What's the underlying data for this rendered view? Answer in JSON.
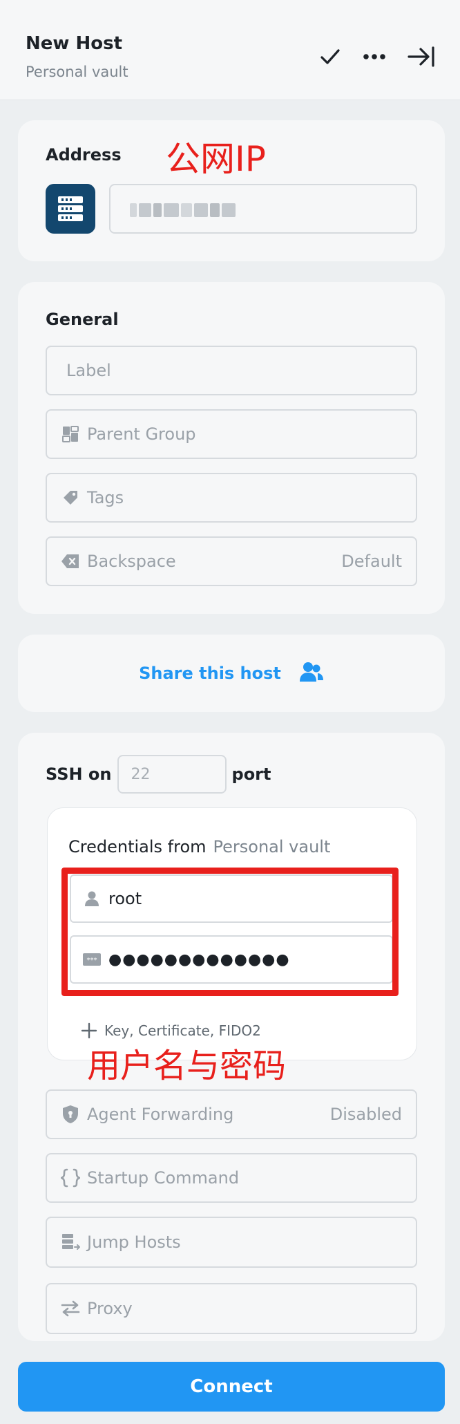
{
  "header": {
    "title": "New Host",
    "subtitle": "Personal vault"
  },
  "address": {
    "label": "Address",
    "annotation": "公网IP"
  },
  "general": {
    "label": "General",
    "fields": {
      "label": "Label",
      "parent_group": "Parent Group",
      "tags": "Tags",
      "backspace": "Backspace",
      "backspace_value": "Default"
    }
  },
  "share": {
    "label": "Share this host"
  },
  "ssh": {
    "prefix": "SSH on",
    "port_placeholder": "22",
    "suffix": "port",
    "credentials": {
      "title": "Credentials from",
      "vault": "Personal vault",
      "username": "root",
      "password_mask": "●●●●●●●●●●●●●",
      "key_link": "Key, Certificate, FIDO2"
    },
    "annotation": "用户名与密码",
    "options": {
      "agent_forwarding": "Agent Forwarding",
      "agent_forwarding_value": "Disabled",
      "startup_command": "Startup Command",
      "jump_hosts": "Jump Hosts",
      "proxy": "Proxy"
    }
  },
  "connect": {
    "label": "Connect"
  },
  "colors": {
    "accent": "#2196f3",
    "annotation_red": "#e8201c",
    "server_icon_bg": "#13476e"
  }
}
